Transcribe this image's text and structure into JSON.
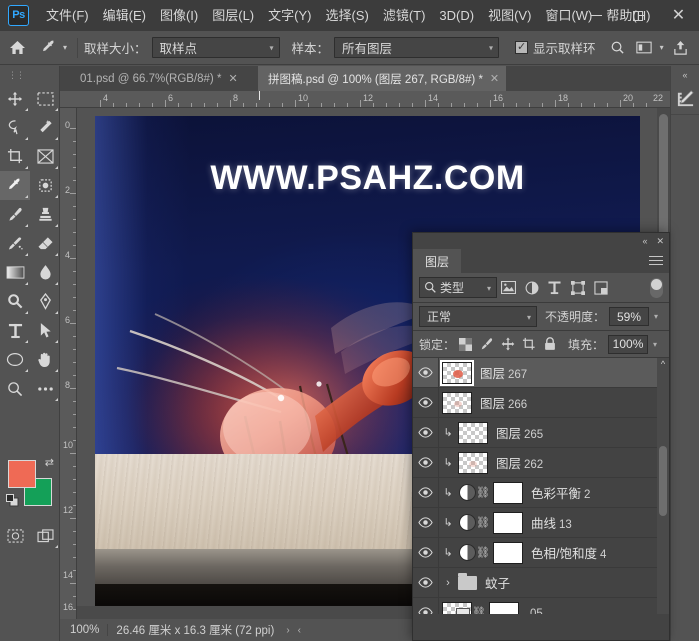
{
  "app": {
    "logo": "Ps",
    "title": "Adobe Photoshop"
  },
  "menubar": {
    "items": [
      {
        "label": "文件(F)",
        "name": "menu-file"
      },
      {
        "label": "编辑(E)",
        "name": "menu-edit"
      },
      {
        "label": "图像(I)",
        "name": "menu-image"
      },
      {
        "label": "图层(L)",
        "name": "menu-layer"
      },
      {
        "label": "文字(Y)",
        "name": "menu-type"
      },
      {
        "label": "选择(S)",
        "name": "menu-select"
      },
      {
        "label": "滤镜(T)",
        "name": "menu-filter"
      },
      {
        "label": "3D(D)",
        "name": "menu-3d"
      },
      {
        "label": "视图(V)",
        "name": "menu-view"
      },
      {
        "label": "窗口(W)",
        "name": "menu-window"
      },
      {
        "label": "帮助(H)",
        "name": "menu-help"
      }
    ],
    "window_controls": {
      "minimize": "minimize-icon",
      "maximize": "maximize-icon",
      "close": "close-icon"
    }
  },
  "options_bar": {
    "home_icon": "home-icon",
    "tool_icon": "eyedropper-icon",
    "sample_size_label": "取样大小：",
    "sample_size_value": "取样点",
    "sample_label": "样本：",
    "sample_value": "所有图层",
    "show_ring_label": "显示取样环",
    "show_ring_checked": true,
    "search_icon": "search-icon",
    "workspace_icon": "workspace-icon",
    "share_icon": "share-icon"
  },
  "tabs": [
    {
      "label": "01.psd @ 66.7%(RGB/8#) *",
      "active": false,
      "name": "tab-doc-01"
    },
    {
      "label": "拼图稿.psd @ 100% (图层 267, RGB/8#) *",
      "active": true,
      "name": "tab-doc-pintugao"
    }
  ],
  "toolbar": {
    "tools": [
      {
        "name": "move-tool",
        "glyph": "move",
        "selected": false
      },
      {
        "name": "marquee-tool",
        "glyph": "marquee",
        "selected": false
      },
      {
        "name": "lasso-tool",
        "glyph": "lasso",
        "selected": false
      },
      {
        "name": "magic-wand-tool",
        "glyph": "wand",
        "selected": false
      },
      {
        "name": "crop-tool",
        "glyph": "crop",
        "selected": false
      },
      {
        "name": "frame-tool",
        "glyph": "frame",
        "selected": false
      },
      {
        "name": "eyedropper-tool",
        "glyph": "eyedropper",
        "selected": true
      },
      {
        "name": "spot-healing-tool",
        "glyph": "healing",
        "selected": false
      },
      {
        "name": "brush-tool",
        "glyph": "brush",
        "selected": false
      },
      {
        "name": "clone-stamp-tool",
        "glyph": "stamp",
        "selected": false
      },
      {
        "name": "history-brush-tool",
        "glyph": "history-brush",
        "selected": false
      },
      {
        "name": "eraser-tool",
        "glyph": "eraser",
        "selected": false
      },
      {
        "name": "gradient-tool",
        "glyph": "gradient",
        "selected": false
      },
      {
        "name": "blur-tool",
        "glyph": "blur",
        "selected": false
      },
      {
        "name": "dodge-tool",
        "glyph": "dodge",
        "selected": false
      },
      {
        "name": "pen-tool",
        "glyph": "pen",
        "selected": false
      },
      {
        "name": "type-tool",
        "glyph": "type",
        "selected": false
      },
      {
        "name": "path-selection-tool",
        "glyph": "arrow",
        "selected": false
      },
      {
        "name": "ellipse-tool",
        "glyph": "ellipse",
        "selected": false
      },
      {
        "name": "hand-tool",
        "glyph": "hand",
        "selected": false
      },
      {
        "name": "zoom-tool",
        "glyph": "zoom",
        "selected": false
      },
      {
        "name": "more-tools",
        "glyph": "more",
        "selected": false
      }
    ],
    "foreground_color": "#ef6a55",
    "background_color": "#14a058",
    "quick_mask_icon": "quick-mask-icon",
    "screen_mode_icon": "screen-mode-icon"
  },
  "rulers": {
    "unit": "厘米",
    "horizontal_labels": [
      "4",
      "6",
      "8",
      "10",
      "12",
      "14",
      "16",
      "18",
      "20",
      "22"
    ],
    "vertical_labels": [
      "0",
      "2",
      "4",
      "6",
      "8",
      "10",
      "12",
      "14",
      "16"
    ]
  },
  "canvas": {
    "watermark": "WWW.PSAHZ.COM",
    "background_color": "#0e1a55",
    "table_color": "#ded3c4"
  },
  "statusbar": {
    "zoom": "100%",
    "dimensions": "26.46 厘米 x 16.3 厘米 (72 ppi)",
    "expand_arrow": "›",
    "collapse_arrow": "‹"
  },
  "right_dock": {
    "collapse_icon": "collapse-panel-icon",
    "items": [
      {
        "name": "measure-log-icon",
        "label": "测量记录"
      }
    ]
  },
  "layers_panel": {
    "collapse_icon": "collapse-icon",
    "close_icon": "close-icon",
    "tab_label": "图层",
    "menu_icon": "panel-menu-icon",
    "filter": {
      "search_icon": "search-icon",
      "type_value": "类型",
      "icons": [
        {
          "name": "filter-pixel-icon"
        },
        {
          "name": "filter-adjustment-icon"
        },
        {
          "name": "filter-type-icon"
        },
        {
          "name": "filter-shape-icon"
        },
        {
          "name": "filter-smartobject-icon"
        }
      ],
      "toggle_on": true
    },
    "blend_mode": "正常",
    "opacity_label": "不透明度：",
    "opacity_value": "59%",
    "lock_label": "锁定：",
    "lock_icons": [
      {
        "name": "lock-transparent-pixels-icon"
      },
      {
        "name": "lock-image-pixels-icon"
      },
      {
        "name": "lock-position-icon"
      },
      {
        "name": "lock-artboard-icon"
      },
      {
        "name": "lock-all-icon"
      }
    ],
    "fill_label": "填充：",
    "fill_value": "100%",
    "rows": [
      {
        "name": "图层",
        "num": "267",
        "kind": "pixel",
        "selected": true,
        "clipped": false,
        "visible": true,
        "thumb": "red-blob"
      },
      {
        "name": "图层",
        "num": "266",
        "kind": "pixel",
        "selected": false,
        "clipped": false,
        "visible": true,
        "thumb": "faint-blob"
      },
      {
        "name": "图层",
        "num": "265",
        "kind": "pixel",
        "selected": false,
        "clipped": true,
        "visible": true,
        "thumb": "empty"
      },
      {
        "name": "图层",
        "num": "262",
        "kind": "pixel",
        "selected": false,
        "clipped": true,
        "visible": true,
        "thumb": "faint-blob"
      },
      {
        "name": "色彩平衡",
        "num": "2",
        "kind": "adjustment",
        "selected": false,
        "clipped": true,
        "visible": true,
        "thumb": "mask-white"
      },
      {
        "name": "曲线",
        "num": "13",
        "kind": "adjustment",
        "selected": false,
        "clipped": true,
        "visible": true,
        "thumb": "mask-white"
      },
      {
        "name": "色相/饱和度",
        "num": "4",
        "kind": "adjustment",
        "selected": false,
        "clipped": true,
        "visible": true,
        "thumb": "mask-white"
      },
      {
        "name": "蚊子",
        "num": "",
        "kind": "group",
        "selected": false,
        "clipped": false,
        "visible": true,
        "thumb": "folder"
      },
      {
        "name": "05",
        "num": "",
        "kind": "smart",
        "selected": false,
        "clipped": false,
        "visible": true,
        "thumb": "smart-object"
      }
    ],
    "scroll_up_icon": "scroll-up-icon"
  }
}
